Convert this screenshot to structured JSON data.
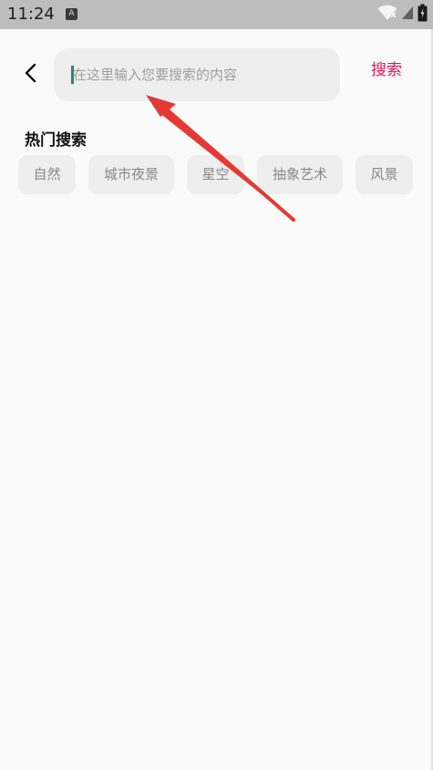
{
  "status_bar": {
    "time": "11:24",
    "notification_icon_letter": "A",
    "icons": [
      "wifi-icon",
      "signal-icon",
      "battery-icon"
    ]
  },
  "header": {
    "back_icon": "chevron-left-icon",
    "search_placeholder": "在这里输入您要搜索的内容",
    "search_value": "",
    "search_button_label": "搜索",
    "accent_color": "#d81b60",
    "cursor_color": "#1f8a74"
  },
  "hot_search": {
    "title": "热门搜索",
    "tags": [
      "自然",
      "城市夜景",
      "星空",
      "抽象艺术",
      "风景"
    ]
  },
  "annotation": {
    "type": "red-arrow",
    "color": "#e53935",
    "points_to": "search-input"
  }
}
